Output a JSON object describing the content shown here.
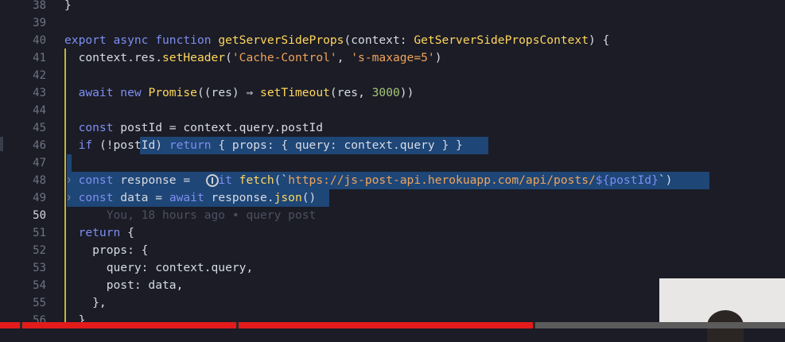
{
  "editor": {
    "lines": [
      {
        "n": "38",
        "segments": [
          {
            "t": "}",
            "c": ""
          }
        ]
      },
      {
        "n": "39",
        "segments": []
      },
      {
        "n": "40",
        "segments": [
          {
            "t": "export ",
            "c": "kw"
          },
          {
            "t": "async ",
            "c": "kw"
          },
          {
            "t": "function ",
            "c": "kw"
          },
          {
            "t": "getServerSideProps",
            "c": "fn"
          },
          {
            "t": "(context: ",
            "c": ""
          },
          {
            "t": "GetServerSidePropsContext",
            "c": "fn"
          },
          {
            "t": ") {",
            "c": ""
          }
        ]
      },
      {
        "n": "41",
        "segments": [
          {
            "t": "  context.res.",
            "c": ""
          },
          {
            "t": "setHeader",
            "c": "fn"
          },
          {
            "t": "(",
            "c": ""
          },
          {
            "t": "'Cache-Control'",
            "c": "str"
          },
          {
            "t": ", ",
            "c": ""
          },
          {
            "t": "'s-maxage=5'",
            "c": "str"
          },
          {
            "t": ")",
            "c": ""
          }
        ]
      },
      {
        "n": "42",
        "segments": []
      },
      {
        "n": "43",
        "segments": [
          {
            "t": "  await ",
            "c": "kw"
          },
          {
            "t": "new ",
            "c": "kw"
          },
          {
            "t": "Promise",
            "c": "fn"
          },
          {
            "t": "((res) ⇒ ",
            "c": ""
          },
          {
            "t": "setTimeout",
            "c": "fn"
          },
          {
            "t": "(res, ",
            "c": ""
          },
          {
            "t": "3000",
            "c": "num"
          },
          {
            "t": "))",
            "c": ""
          }
        ]
      },
      {
        "n": "44",
        "segments": []
      },
      {
        "n": "45",
        "segments": [
          {
            "t": "  const ",
            "c": "kw"
          },
          {
            "t": "postId = context.query.postId",
            "c": ""
          }
        ]
      },
      {
        "n": "46",
        "segments": [
          {
            "t": "  if ",
            "c": "kw"
          },
          {
            "t": "(!postId) ",
            "c": ""
          },
          {
            "t": "return ",
            "c": "kw"
          },
          {
            "t": "{ props: { query: context.query } }",
            "c": ""
          }
        ]
      },
      {
        "n": "47",
        "segments": []
      },
      {
        "n": "48",
        "segments": [
          {
            "t": "  const ",
            "c": "kw"
          },
          {
            "t": "response = ",
            "c": ""
          },
          {
            "t": "   ",
            "c": ""
          },
          {
            "t": "it ",
            "c": "kw"
          },
          {
            "t": "fetch",
            "c": "fn"
          },
          {
            "t": "(`",
            "c": ""
          },
          {
            "t": "https://js-post-api.herokuapp.com/api/posts/",
            "c": "str"
          },
          {
            "t": "${postId}",
            "c": "kw"
          },
          {
            "t": "`)",
            "c": ""
          }
        ]
      },
      {
        "n": "49",
        "segments": [
          {
            "t": "  const ",
            "c": "kw"
          },
          {
            "t": "data = ",
            "c": ""
          },
          {
            "t": "await ",
            "c": "kw"
          },
          {
            "t": "response.",
            "c": ""
          },
          {
            "t": "json",
            "c": "fn"
          },
          {
            "t": "()",
            "c": ""
          }
        ]
      },
      {
        "n": "50",
        "segments": [
          {
            "t": "      You, 18 hours ago • query post",
            "c": "blame"
          }
        ]
      },
      {
        "n": "51",
        "segments": [
          {
            "t": "  return ",
            "c": "kw"
          },
          {
            "t": "{",
            "c": ""
          }
        ]
      },
      {
        "n": "52",
        "segments": [
          {
            "t": "    props: {",
            "c": ""
          }
        ]
      },
      {
        "n": "53",
        "segments": [
          {
            "t": "      query: context.query,",
            "c": ""
          }
        ]
      },
      {
        "n": "54",
        "segments": [
          {
            "t": "      post: data,",
            "c": ""
          }
        ]
      },
      {
        "n": "55",
        "segments": [
          {
            "t": "    },",
            "c": ""
          }
        ]
      },
      {
        "n": "56",
        "segments": [
          {
            "t": "  }",
            "c": ""
          }
        ]
      }
    ],
    "active_line": "50"
  },
  "video_player": {
    "progress_fraction": 0.68
  },
  "colors": {
    "keyword": "#7e8ef1",
    "function": "#ffd75e",
    "string": "#f0a35a",
    "number": "#a8c77a",
    "selection": "#1f4e86",
    "progress": "#e31b1b"
  }
}
